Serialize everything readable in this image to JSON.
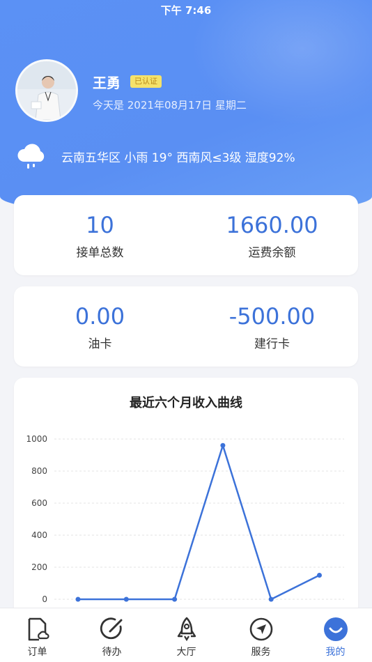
{
  "status_bar": {
    "time": "下午 7:46"
  },
  "profile": {
    "name": "王勇",
    "badge": "已认证",
    "date_line": "今天是 2021年08月17日 星期二"
  },
  "weather": {
    "icon": "cloud-rain-icon",
    "text": "云南五华区 小雨 19° 西南风≤3级 湿度92%"
  },
  "stats_row1": [
    {
      "value": "10",
      "label": "接单总数"
    },
    {
      "value": "1660.00",
      "label": "运费余额"
    }
  ],
  "stats_row2": [
    {
      "value": "0.00",
      "label": "油卡"
    },
    {
      "value": "-500.00",
      "label": "建行卡"
    }
  ],
  "chart_data": {
    "type": "line",
    "title": "最近六个月收入曲线",
    "y_ticks": [
      "1000",
      "800",
      "600",
      "400",
      "200",
      "0"
    ],
    "ylim": [
      0,
      1000
    ],
    "grid": true,
    "series": [
      {
        "values": [
          0,
          0,
          0,
          960,
          0,
          150
        ]
      }
    ],
    "line_color": "#3c72d9"
  },
  "tabs": [
    {
      "label": "订单",
      "icon": "order-document-icon"
    },
    {
      "label": "待办",
      "icon": "todo-edit-icon"
    },
    {
      "label": "大厅",
      "icon": "rocket-icon"
    },
    {
      "label": "服务",
      "icon": "navigation-compass-icon"
    },
    {
      "label": "我的",
      "icon": "smile-profile-icon",
      "active": true
    }
  ],
  "colors": {
    "header": "#5b91f5",
    "accent": "#3c72d9",
    "badge": "#f5e26a"
  }
}
